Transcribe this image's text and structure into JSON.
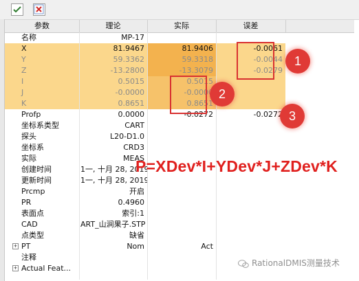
{
  "toolbar": {
    "check_icon": "checkbox-check-icon",
    "clear_icon": "checkbox-x-icon"
  },
  "header": {
    "col_param": "参数",
    "col_nominal": "理论",
    "col_actual": "实际",
    "col_deviation": "误差"
  },
  "rows": [
    {
      "label": "名称",
      "nominal": "MP-17",
      "actual": "",
      "deviation": ""
    },
    {
      "label": "X",
      "nominal": "81.9467",
      "actual": "81.9406",
      "deviation": "-0.0061"
    },
    {
      "label": "Y",
      "nominal": "59.3362",
      "actual": "59.3318",
      "deviation": "-0.0044"
    },
    {
      "label": "Z",
      "nominal": "-13.2800",
      "actual": "-13.3079",
      "deviation": "-0.0279"
    },
    {
      "label": "I",
      "nominal": "0.5015",
      "actual": "0.5015",
      "deviation": ""
    },
    {
      "label": "J",
      "nominal": "-0.0000",
      "actual": "-0.0000",
      "deviation": ""
    },
    {
      "label": "K",
      "nominal": "0.8651",
      "actual": "0.8651",
      "deviation": ""
    },
    {
      "label": "Profp",
      "nominal": "0.0000",
      "actual": "-0.0272",
      "deviation": "-0.0272"
    },
    {
      "label": "坐标系类型",
      "nominal": "CART",
      "actual": "",
      "deviation": ""
    },
    {
      "label": "探头",
      "nominal": "L20-D1.0",
      "actual": "",
      "deviation": ""
    },
    {
      "label": "坐标系",
      "nominal": "CRD3",
      "actual": "",
      "deviation": ""
    },
    {
      "label": "实际",
      "nominal": "MEAS",
      "actual": "",
      "deviation": ""
    },
    {
      "label": "创建时间",
      "nominal": "1一, 十月 28, 2019",
      "actual": "",
      "deviation": ""
    },
    {
      "label": "更新时间",
      "nominal": "1一, 十月 28, 2019",
      "actual": "",
      "deviation": ""
    },
    {
      "label": "Prcmp",
      "nominal": "开启",
      "actual": "",
      "deviation": ""
    },
    {
      "label": "PR",
      "nominal": "0.4960",
      "actual": "",
      "deviation": ""
    },
    {
      "label": "表面点",
      "nominal": "索引:1",
      "actual": "",
      "deviation": ""
    },
    {
      "label": "CAD",
      "nominal": "ART_山涧果子.STP",
      "actual": "",
      "deviation": ""
    },
    {
      "label": "点类型",
      "nominal": "缺省",
      "actual": "",
      "deviation": ""
    },
    {
      "label": "PT",
      "nominal": "Nom",
      "actual": "Act",
      "deviation": ""
    },
    {
      "label": "注释",
      "nominal": "",
      "actual": "",
      "deviation": ""
    },
    {
      "label": "Actual Feat...",
      "nominal": "",
      "actual": "",
      "deviation": ""
    }
  ],
  "annotations": {
    "badge1": "1",
    "badge2": "2",
    "badge3": "3",
    "formula": "P=XDev*I+YDev*J+ZDev*K",
    "watermark": "RationalDMIS测量技术"
  },
  "colors": {
    "highlight_row": "#fbd78c",
    "highlight_actual": "#f3b24e",
    "annotation_red": "#e0201e"
  }
}
